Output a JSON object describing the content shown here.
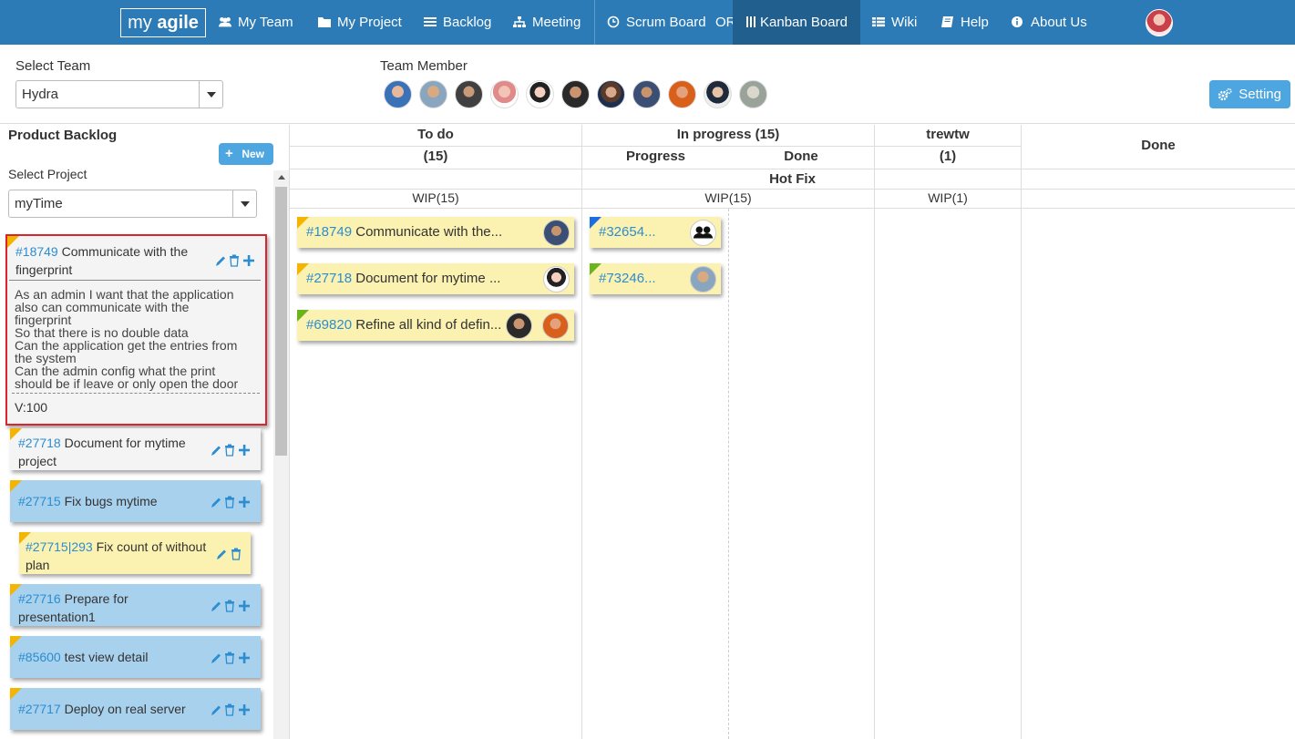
{
  "nav": {
    "logo": "my agile",
    "logo_prefix": "my ",
    "logo_strong": "agile",
    "items": [
      {
        "label": "My Team",
        "icon": "users-icon"
      },
      {
        "label": "My Project",
        "icon": "folder-icon"
      },
      {
        "label": "Backlog",
        "icon": "list-icon"
      },
      {
        "label": "Meeting",
        "icon": "sitemap-icon"
      },
      {
        "label": "Scrum Board",
        "icon": "clock-icon"
      },
      {
        "label": "Kanban Board",
        "icon": "columns-icon"
      },
      {
        "label": "Wiki",
        "icon": "table-icon"
      },
      {
        "label": "Help",
        "icon": "book-icon"
      },
      {
        "label": "About Us",
        "icon": "info-icon"
      }
    ],
    "or_label": "OR",
    "active": "Kanban Board",
    "brand_color": "#2c7bb6"
  },
  "filters": {
    "team_label": "Select Team",
    "team_value": "Hydra",
    "member_label": "Team Member",
    "member_count": 11,
    "setting_label": "Setting"
  },
  "backlog": {
    "title": "Product Backlog",
    "new_label": "New",
    "project_label": "Select Project",
    "project_value": "myTime",
    "items": [
      {
        "id": "#18749",
        "title": "Communicate with the fingerprint",
        "color": "#f4f4f4",
        "description": [
          "As an admin I want that the application",
          "also can communicate with the",
          "fingerprint",
          "So that there is no double data",
          "Can the application get the entries from",
          "the system",
          "Can the admin config what the print",
          "should be if leave or only open the door"
        ],
        "version": "V:100"
      },
      {
        "id": "#27718",
        "title": "Document for mytime project"
      },
      {
        "id": "#27715",
        "title": "Fix bugs mytime"
      },
      {
        "id": "#27715|293",
        "title": "Fix count of without plan"
      },
      {
        "id": "#27716",
        "title": "Prepare for presentation1"
      },
      {
        "id": "#85600",
        "title": "test view detail"
      },
      {
        "id": "#27717",
        "title": "Deploy on real server"
      }
    ]
  },
  "board": {
    "columns": [
      {
        "title": "To do",
        "count": "(15)",
        "wip": "WIP(15)"
      },
      {
        "title": "In progress (15)",
        "sub": [
          "Progress",
          "Done"
        ],
        "wip": "WIP(15)"
      },
      {
        "title": "trewtw",
        "count": "(1)",
        "wip": "WIP(1)"
      },
      {
        "title": "Done"
      }
    ],
    "swimlane": "Hot Fix",
    "cards": {
      "todo": [
        {
          "id": "#18749",
          "title": "Communicate with the..."
        },
        {
          "id": "#27718",
          "title": "Document for mytime ..."
        },
        {
          "id": "#69820",
          "title": "Refine all kind of defin..."
        }
      ],
      "progress": [
        {
          "id": "#32654..."
        },
        {
          "id": "#73246..."
        }
      ]
    }
  }
}
